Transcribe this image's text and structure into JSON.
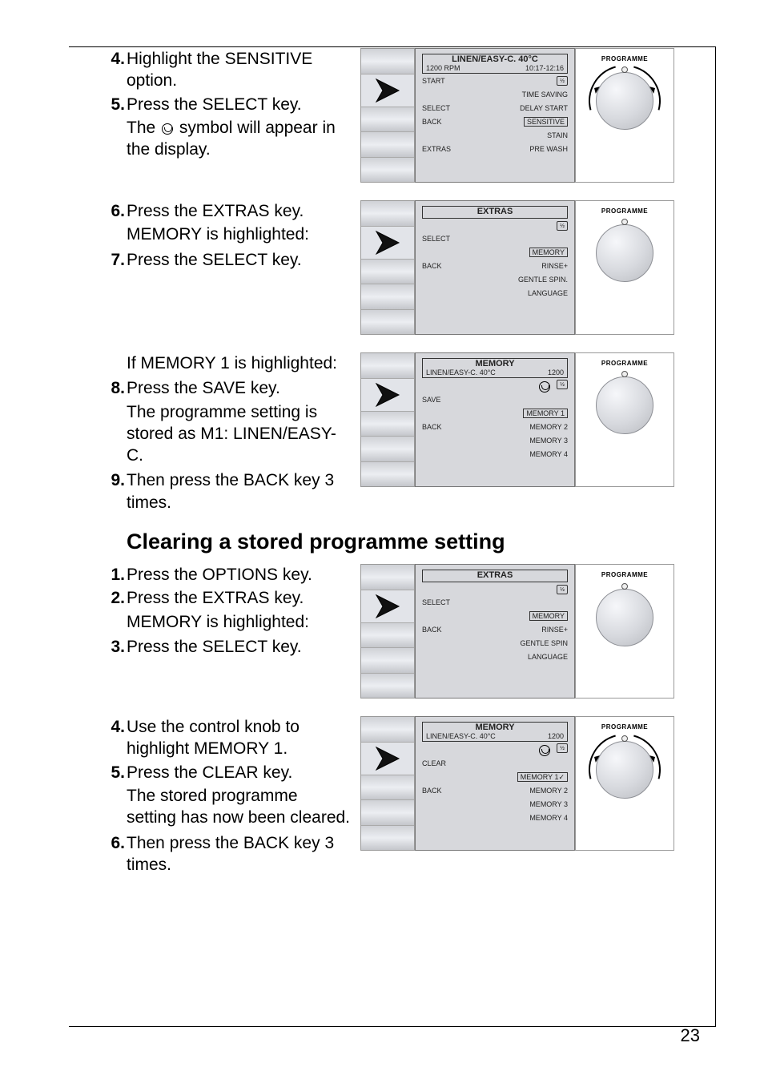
{
  "page_number": "23",
  "steps_a": [
    {
      "n": "4.",
      "t": "Highlight the SENSITIVE option."
    },
    {
      "n": "5.",
      "t": "Press the SELECT key."
    }
  ],
  "step5_line2a": "The ",
  "step5_line2b": " symbol will appear in the display.",
  "step6": {
    "n": "6.",
    "t": "Press the EXTRAS key."
  },
  "note1": "MEMORY is highlighted:",
  "step7": {
    "n": "7.",
    "t": "Press the SELECT key."
  },
  "note2": "If MEMORY 1 is highlighted:",
  "step8": {
    "n": "8.",
    "t": "Press the SAVE key."
  },
  "step8_extra": "The programme setting is stored as M1: LINEN/EASY-C.",
  "step9": {
    "n": "9.",
    "t": "Then press the BACK key 3 times."
  },
  "heading": "Clearing a stored programme setting",
  "clear_steps_a": [
    {
      "n": "1.",
      "t": "Press the OPTIONS key."
    },
    {
      "n": "2.",
      "t": "Press the EXTRAS key."
    }
  ],
  "clear_note": "MEMORY is highlighted:",
  "clear_step3": {
    "n": "3.",
    "t": "Press the SELECT key."
  },
  "clear_step4": {
    "n": "4.",
    "t": "Use the control knob to highlight MEMORY 1."
  },
  "clear_step5": {
    "n": "5.",
    "t": "Press the CLEAR key."
  },
  "clear_step5_extra": "The stored programme setting has now been cleared.",
  "clear_step6": {
    "n": "6.",
    "t": "Then press the BACK key 3 times."
  },
  "knob_label": "PROGRAMME",
  "panel1": {
    "title": "LINEN/EASY-C. 40°C",
    "sub_left": "1200 RPM",
    "sub_right": "10:17-12:16",
    "rows": [
      {
        "l": "START",
        "r": "",
        "icon": true
      },
      {
        "l": "",
        "r": "TIME SAVING"
      },
      {
        "l": "SELECT",
        "r": "DELAY START"
      },
      {
        "l": "BACK",
        "r": "SENSITIVE",
        "boxed": true
      },
      {
        "l": "",
        "r": "STAIN"
      },
      {
        "l": "EXTRAS",
        "r": "PRE WASH"
      }
    ],
    "arrows": true
  },
  "panel2": {
    "title": "EXTRAS",
    "rows": [
      {
        "l": "",
        "r": "",
        "icon": true
      },
      {
        "l": "SELECT",
        "r": ""
      },
      {
        "l": "",
        "r": "MEMORY",
        "boxed": true
      },
      {
        "l": "BACK",
        "r": "RINSE+"
      },
      {
        "l": "",
        "r": "GENTLE SPIN."
      },
      {
        "l": "",
        "r": "LANGUAGE"
      }
    ],
    "arrows": false
  },
  "panel3": {
    "title": "MEMORY",
    "sub_left": "LINEN/EASY-C. 40°C",
    "sub_right": "1200",
    "rows": [
      {
        "l": "",
        "r": "",
        "icon2": true
      },
      {
        "l": "SAVE",
        "r": ""
      },
      {
        "l": "",
        "r": "MEMORY 1",
        "boxed": true
      },
      {
        "l": "BACK",
        "r": "MEMORY 2"
      },
      {
        "l": "",
        "r": "MEMORY 3"
      },
      {
        "l": "",
        "r": "MEMORY 4"
      }
    ],
    "arrows": false
  },
  "panel4": {
    "title": "EXTRAS",
    "rows": [
      {
        "l": "",
        "r": "",
        "icon": true
      },
      {
        "l": "SELECT",
        "r": ""
      },
      {
        "l": "",
        "r": "MEMORY",
        "boxed": true
      },
      {
        "l": "BACK",
        "r": "RINSE+"
      },
      {
        "l": "",
        "r": "GENTLE SPIN"
      },
      {
        "l": "",
        "r": "LANGUAGE"
      }
    ],
    "arrows": false
  },
  "panel5": {
    "title": "MEMORY",
    "sub_left": "LINEN/EASY-C. 40°C",
    "sub_right": "1200",
    "rows": [
      {
        "l": "",
        "r": "",
        "icon2": true
      },
      {
        "l": "CLEAR",
        "r": ""
      },
      {
        "l": "",
        "r": "MEMORY 1✓",
        "boxed": true
      },
      {
        "l": "BACK",
        "r": "MEMORY 2"
      },
      {
        "l": "",
        "r": "MEMORY 3"
      },
      {
        "l": "",
        "r": "MEMORY 4"
      }
    ],
    "arrows": true
  }
}
